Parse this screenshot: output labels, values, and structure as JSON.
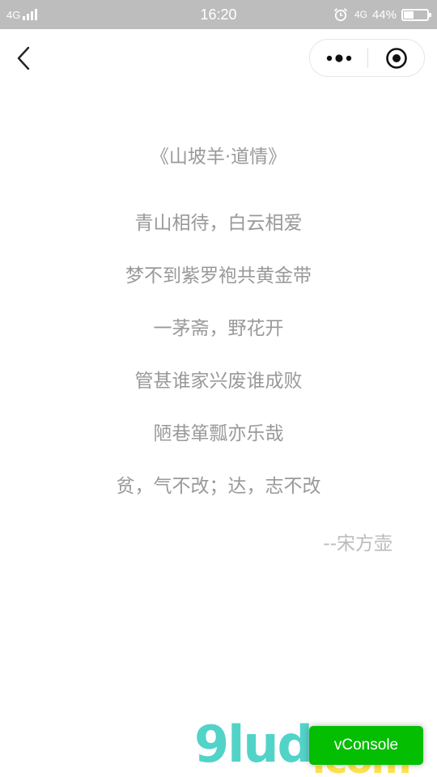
{
  "status_bar": {
    "network_left": "4G",
    "time": "16:20",
    "network_right": "4G",
    "battery_text": "44%",
    "battery_level": 0.44
  },
  "nav": {
    "back_icon": "chevron-left-icon",
    "menu_icon": "more-dots-icon",
    "close_icon": "target-circle-icon"
  },
  "poem": {
    "title": "《山坡羊·道情》",
    "lines": [
      "青山相待，白云相爱",
      "梦不到紫罗袍共黄金带",
      "一茅斋，野花开",
      "管甚谁家兴废谁成败",
      "陋巷箪瓢亦乐哉",
      "贫，气不改；达，志不改"
    ],
    "author": "--宋方壶"
  },
  "watermark": {
    "number": "9lud",
    "domain": ".com"
  },
  "vconsole": {
    "label": "vConsole",
    "color": "#04be02"
  }
}
